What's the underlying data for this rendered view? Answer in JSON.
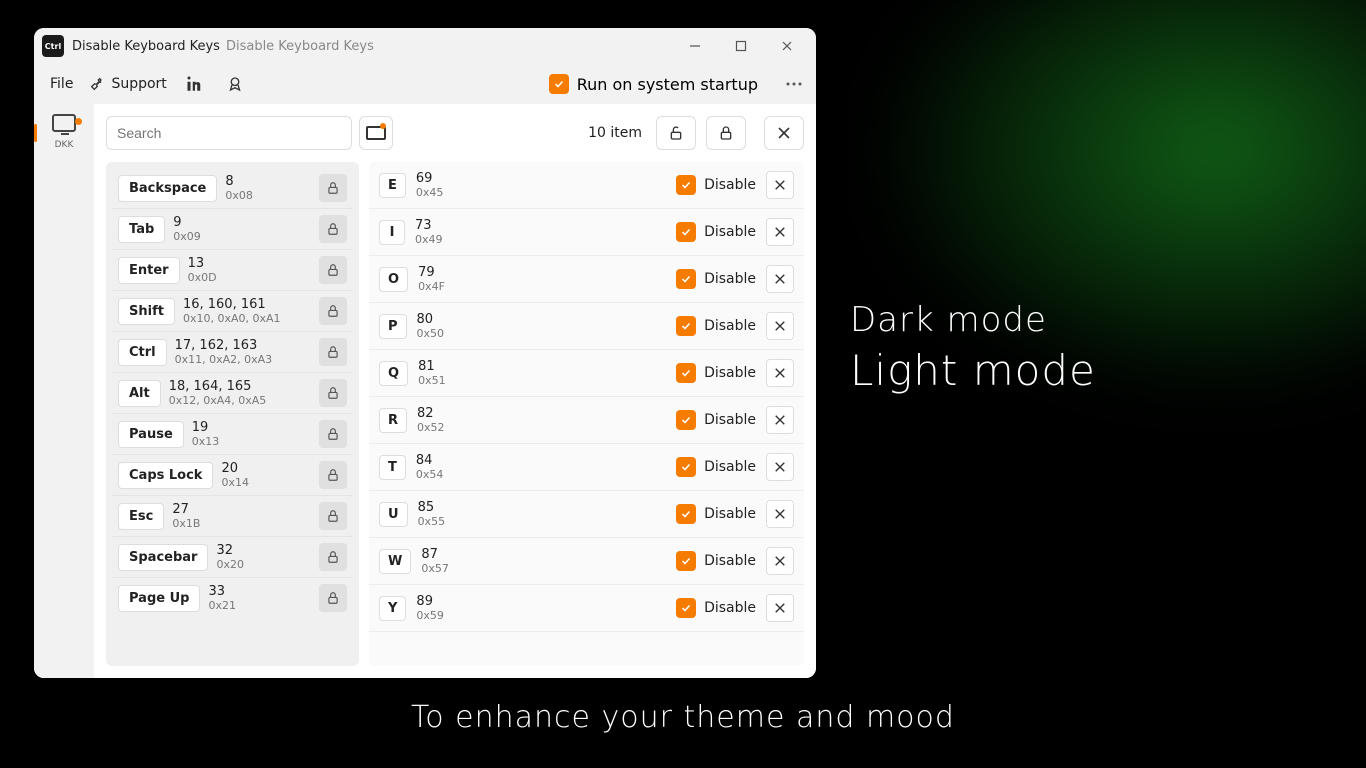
{
  "titlebar": {
    "icon_text": "Ctrl",
    "title1": "Disable Keyboard Keys",
    "title2": "Disable Keyboard Keys"
  },
  "toolbar": {
    "file": "File",
    "support": "Support",
    "startup_label": "Run on system startup"
  },
  "rail": {
    "label": "DKK"
  },
  "search": {
    "placeholder": "Search"
  },
  "count": "10 item",
  "left_keys": [
    {
      "name": "Backspace",
      "code": "8",
      "hex": "0x08"
    },
    {
      "name": "Tab",
      "code": "9",
      "hex": "0x09"
    },
    {
      "name": "Enter",
      "code": "13",
      "hex": "0x0D"
    },
    {
      "name": "Shift",
      "code": "16, 160, 161",
      "hex": "0x10, 0xA0, 0xA1"
    },
    {
      "name": "Ctrl",
      "code": "17, 162, 163",
      "hex": "0x11, 0xA2, 0xA3"
    },
    {
      "name": "Alt",
      "code": "18, 164, 165",
      "hex": "0x12, 0xA4, 0xA5"
    },
    {
      "name": "Pause",
      "code": "19",
      "hex": "0x13"
    },
    {
      "name": "Caps Lock",
      "code": "20",
      "hex": "0x14"
    },
    {
      "name": "Esc",
      "code": "27",
      "hex": "0x1B"
    },
    {
      "name": "Spacebar",
      "code": "32",
      "hex": "0x20"
    },
    {
      "name": "Page Up",
      "code": "33",
      "hex": "0x21"
    }
  ],
  "right_keys": [
    {
      "name": "E",
      "code": "69",
      "hex": "0x45",
      "label": "Disable"
    },
    {
      "name": "I",
      "code": "73",
      "hex": "0x49",
      "label": "Disable"
    },
    {
      "name": "O",
      "code": "79",
      "hex": "0x4F",
      "label": "Disable"
    },
    {
      "name": "P",
      "code": "80",
      "hex": "0x50",
      "label": "Disable"
    },
    {
      "name": "Q",
      "code": "81",
      "hex": "0x51",
      "label": "Disable"
    },
    {
      "name": "R",
      "code": "82",
      "hex": "0x52",
      "label": "Disable"
    },
    {
      "name": "T",
      "code": "84",
      "hex": "0x54",
      "label": "Disable"
    },
    {
      "name": "U",
      "code": "85",
      "hex": "0x55",
      "label": "Disable"
    },
    {
      "name": "W",
      "code": "87",
      "hex": "0x57",
      "label": "Disable"
    },
    {
      "name": "Y",
      "code": "89",
      "hex": "0x59",
      "label": "Disable"
    }
  ],
  "promo": {
    "dark": "Dark mode",
    "light": "Light mode"
  },
  "tagline": "To enhance your theme and mood"
}
